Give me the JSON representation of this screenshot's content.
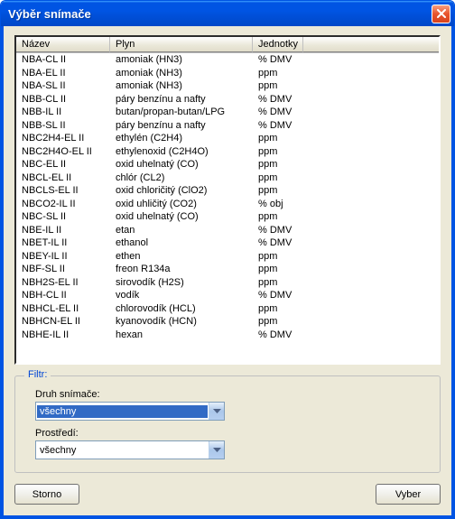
{
  "window": {
    "title": "Výběr snímače"
  },
  "columns": {
    "name": "Název",
    "gas": "Plyn",
    "units": "Jednotky"
  },
  "rows": [
    {
      "name": "NBA-CL II",
      "gas": "amoniak (HN3)",
      "units": "% DMV"
    },
    {
      "name": "NBA-EL II",
      "gas": "amoniak (NH3)",
      "units": "ppm"
    },
    {
      "name": "NBA-SL II",
      "gas": "amoniak (NH3)",
      "units": "ppm"
    },
    {
      "name": "NBB-CL II",
      "gas": "páry benzínu a nafty",
      "units": "% DMV"
    },
    {
      "name": "NBB-IL II",
      "gas": "butan/propan-butan/LPG",
      "units": "% DMV"
    },
    {
      "name": "NBB-SL II",
      "gas": "páry benzínu a nafty",
      "units": "% DMV"
    },
    {
      "name": "NBC2H4-EL II",
      "gas": "ethylén (C2H4)",
      "units": "ppm"
    },
    {
      "name": "NBC2H4O-EL II",
      "gas": "ethylenoxid (C2H4O)",
      "units": "ppm"
    },
    {
      "name": "NBC-EL II",
      "gas": "oxid uhelnatý (CO)",
      "units": "ppm"
    },
    {
      "name": "NBCL-EL II",
      "gas": "chlór (CL2)",
      "units": "ppm"
    },
    {
      "name": "NBCLS-EL II",
      "gas": "oxid chloričitý (ClO2)",
      "units": "ppm"
    },
    {
      "name": "NBCO2-IL II",
      "gas": "oxid uhličitý (CO2)",
      "units": "% obj"
    },
    {
      "name": "NBC-SL II",
      "gas": "oxid uhelnatý (CO)",
      "units": "ppm"
    },
    {
      "name": "NBE-IL II",
      "gas": "etan",
      "units": "% DMV"
    },
    {
      "name": "NBET-IL II",
      "gas": "ethanol",
      "units": "% DMV"
    },
    {
      "name": "NBEY-IL II",
      "gas": "ethen",
      "units": "ppm"
    },
    {
      "name": "NBF-SL II",
      "gas": "freon R134a",
      "units": "ppm"
    },
    {
      "name": "NBH2S-EL II",
      "gas": "sirovodík (H2S)",
      "units": "ppm"
    },
    {
      "name": "NBH-CL II",
      "gas": "vodík",
      "units": "% DMV"
    },
    {
      "name": "NBHCL-EL II",
      "gas": "chlorovodík (HCL)",
      "units": "ppm"
    },
    {
      "name": "NBHCN-EL II",
      "gas": "kyanovodík (HCN)",
      "units": "ppm"
    },
    {
      "name": "NBHE-IL II",
      "gas": "hexan",
      "units": "% DMV"
    }
  ],
  "filter": {
    "legend": "Filtr:",
    "sensor_type_label": "Druh snímače:",
    "sensor_type_value": "všechny",
    "env_label": "Prostředí:",
    "env_value": "všechny"
  },
  "buttons": {
    "cancel": "Storno",
    "select": "Vyber"
  }
}
